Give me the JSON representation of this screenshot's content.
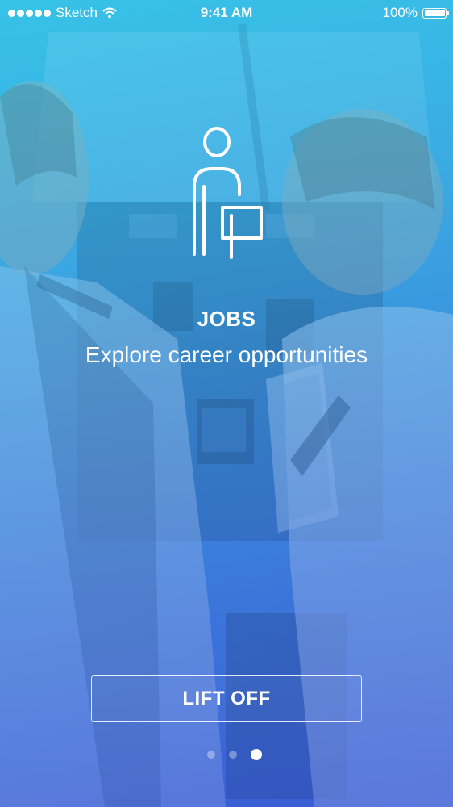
{
  "status_bar": {
    "carrier": "Sketch",
    "time": "9:41 AM",
    "battery": "100%"
  },
  "hero": {
    "icon": "person-with-briefcase-icon",
    "title": "JOBS",
    "subtitle": "Explore career opportunities"
  },
  "cta": {
    "label": "LIFT OFF"
  },
  "pagination": {
    "total": 3,
    "active_index": 2
  },
  "colors": {
    "gradient_top": "#37c5e8",
    "gradient_bottom": "#3a5fd3",
    "text": "#ffffff"
  },
  "background_image": "pilots-in-cockpit"
}
